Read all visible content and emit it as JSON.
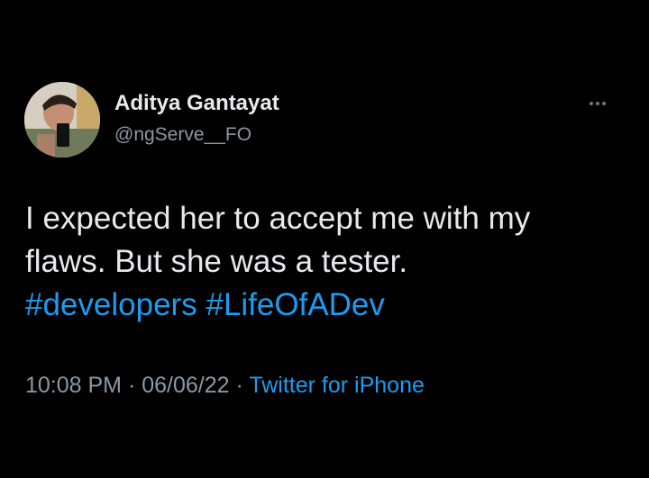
{
  "author": {
    "name": "Aditya Gantayat",
    "handle": "@ngServe__FO"
  },
  "tweet": {
    "line1": "I expected her to accept me with my",
    "line2": "flaws. But she was a tester.",
    "hashtags": [
      "#developers",
      "#LifeOfADev"
    ]
  },
  "meta": {
    "time": "10:08 PM",
    "separator": "·",
    "date": "06/06/22",
    "source": "Twitter for iPhone"
  },
  "icons": {
    "more": "more-options-icon"
  },
  "colors": {
    "background": "#000000",
    "text": "#e7e9ea",
    "secondary": "#8b98a5",
    "link": "#1d9bf0"
  }
}
